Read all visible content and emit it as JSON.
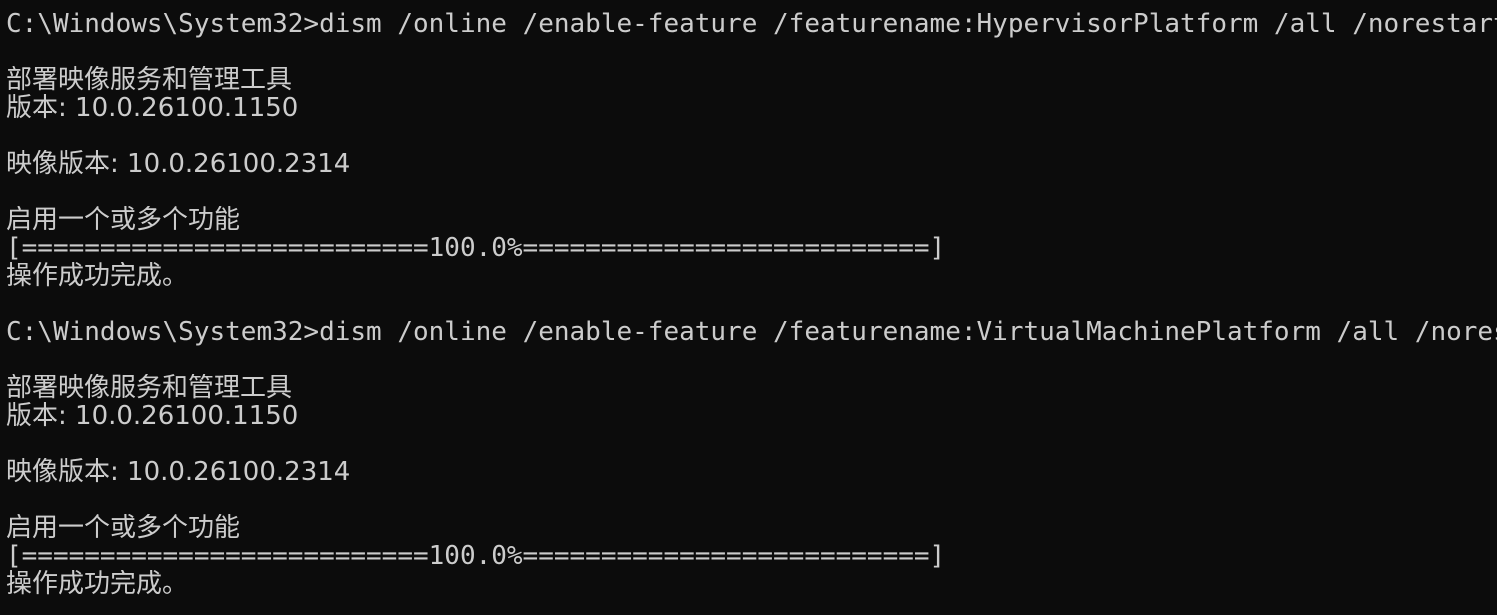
{
  "console": {
    "colors": {
      "background": "#0c0c0c",
      "foreground": "#cccccc"
    },
    "blocks": [
      {
        "prompt": "C:\\Windows\\System32>",
        "command": "dism /online /enable-feature /featurename:HypervisorPlatform /all /norestart",
        "tool_title": "部署映像服务和管理工具",
        "version": "版本: 10.0.26100.1150",
        "image_version": "映像版本: 10.0.26100.2314",
        "enabling": "启用一个或多个功能",
        "progress_bar": "[==========================100.0%==========================]",
        "progress_percent": 100.0,
        "result": "操作成功完成。"
      },
      {
        "prompt": "C:\\Windows\\System32>",
        "command": "dism /online /enable-feature /featurename:VirtualMachinePlatform /all /norestart",
        "tool_title": "部署映像服务和管理工具",
        "version": "版本: 10.0.26100.1150",
        "image_version": "映像版本: 10.0.26100.2314",
        "enabling": "启用一个或多个功能",
        "progress_bar": "[==========================100.0%==========================]",
        "progress_percent": 100.0,
        "result": "操作成功完成。"
      }
    ]
  }
}
